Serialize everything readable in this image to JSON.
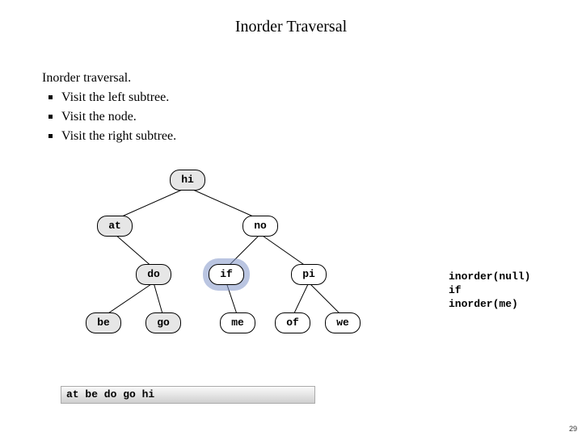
{
  "title": "Inorder Traversal",
  "description": {
    "heading": "Inorder traversal.",
    "bullets": [
      "Visit the left subtree.",
      "Visit the node.",
      "Visit the right subtree."
    ]
  },
  "tree": {
    "nodes": {
      "hi": "hi",
      "at": "at",
      "no": "no",
      "do": "do",
      "if": "if",
      "pi": "pi",
      "be": "be",
      "go": "go",
      "me": "me",
      "of": "of",
      "we": "we"
    },
    "highlighted": "if",
    "muted": [
      "hi",
      "at",
      "do",
      "be",
      "go"
    ]
  },
  "callstack": [
    "inorder(null)",
    "if",
    "inorder(me)"
  ],
  "output": "at be do go hi",
  "page_number": "29"
}
